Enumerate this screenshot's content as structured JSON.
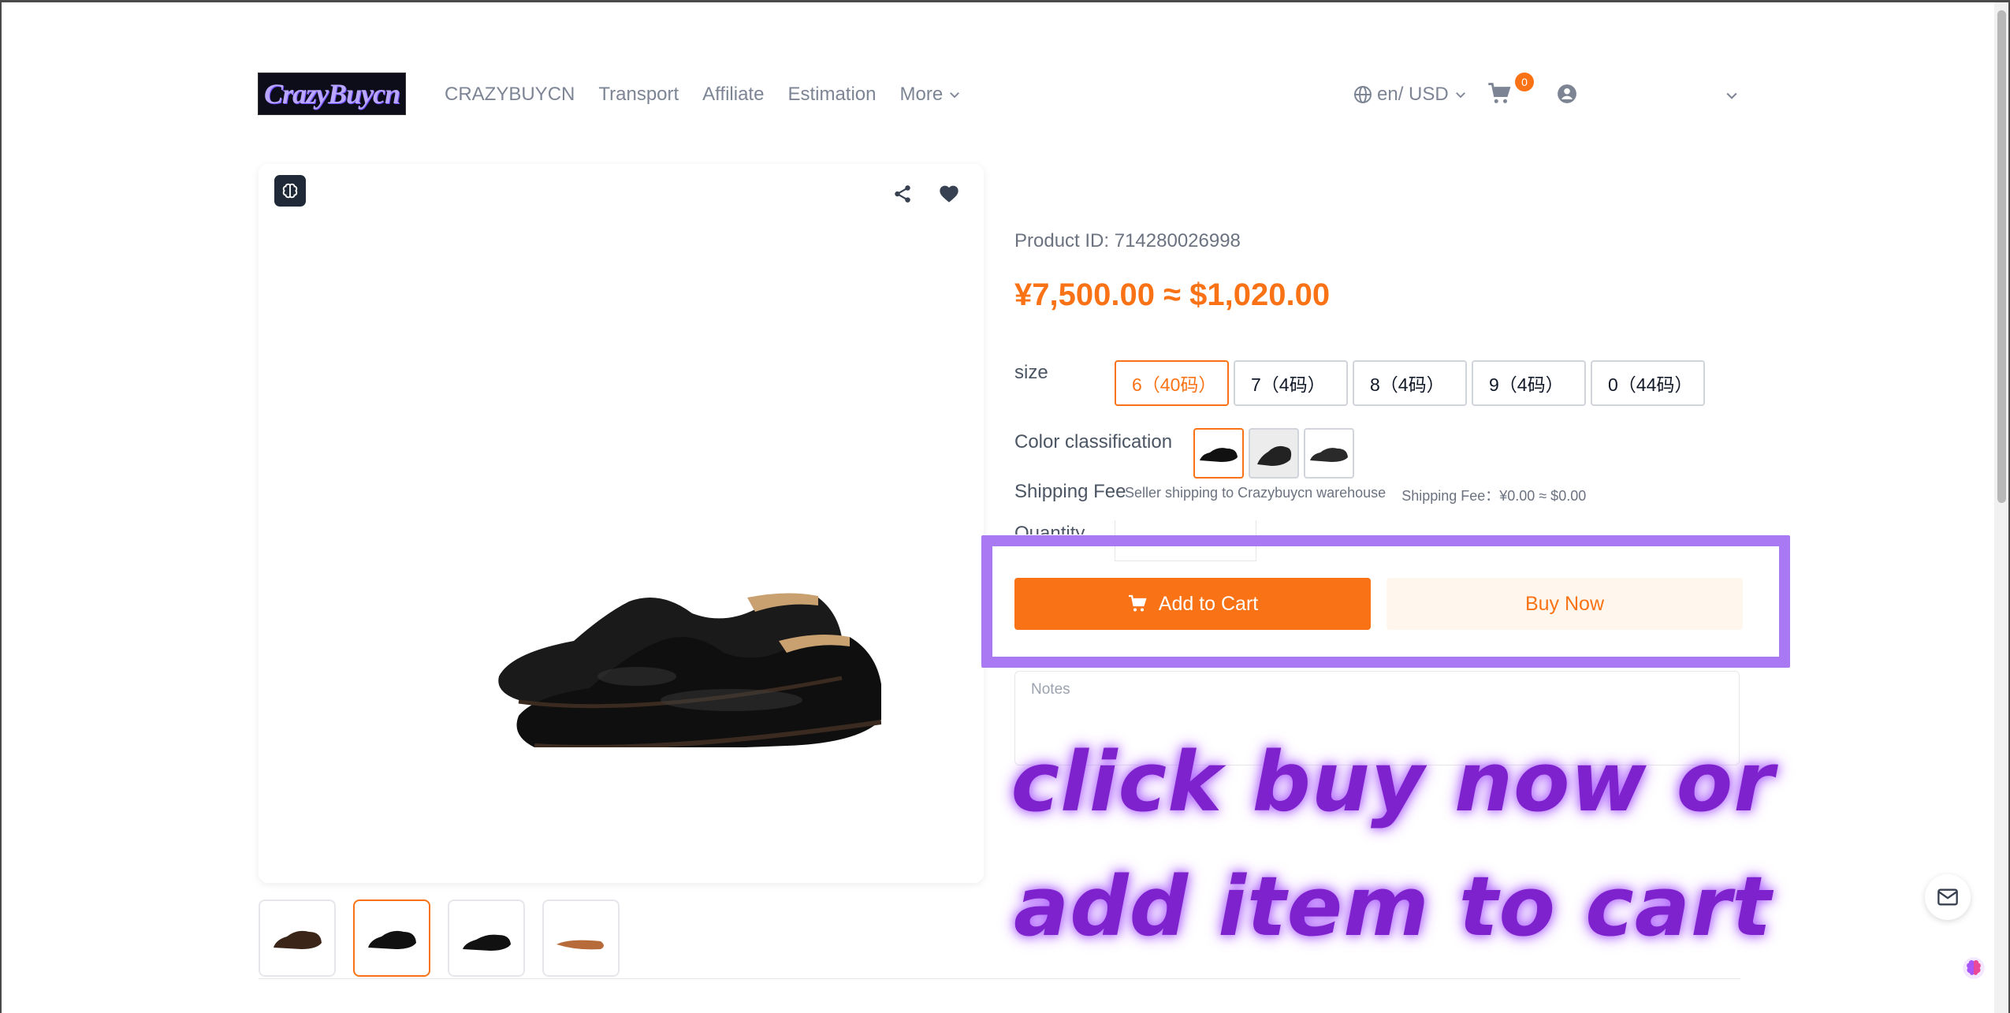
{
  "header": {
    "logo_text": "CrazyBuycn",
    "nav": [
      {
        "label": "CRAZYBUYCN"
      },
      {
        "label": "Transport"
      },
      {
        "label": "Affiliate"
      },
      {
        "label": "Estimation"
      },
      {
        "label": "More"
      }
    ],
    "lang_currency": "en/ USD",
    "cart_count": "0"
  },
  "product": {
    "id_label": "Product ID",
    "id_sep": ":",
    "id_value": "714280026998",
    "price": "¥7,500.00 ≈ $1,020.00",
    "size_label": "size",
    "sizes": [
      {
        "label": "6（40码）",
        "selected": true
      },
      {
        "label": "7（4码）",
        "selected": false
      },
      {
        "label": "8（4码）",
        "selected": false
      },
      {
        "label": "9（4码）",
        "selected": false
      },
      {
        "label": "0（44码）",
        "selected": false
      }
    ],
    "color_label": "Color classification",
    "shipping_label": "Shipping Fee",
    "shipping_method": "Seller shipping to Crazybuycn warehouse",
    "shipping_fee": "Shipping Fee：¥0.00 ≈ $0.00",
    "quantity_label": "Quantity",
    "add_to_cart": "Add to Cart",
    "buy_now": "Buy Now",
    "notes_placeholder": "Notes"
  },
  "annotation": {
    "text": "click buy now or add item to cart",
    "color": "#7e22ce",
    "highlight_color": "#a879f2"
  },
  "colors": {
    "accent": "#f97316",
    "nav_text": "#7d8595"
  },
  "icons": [
    "globe-icon",
    "cart-icon",
    "user-icon",
    "brain-icon",
    "share-icon",
    "heart-icon",
    "mail-icon"
  ]
}
